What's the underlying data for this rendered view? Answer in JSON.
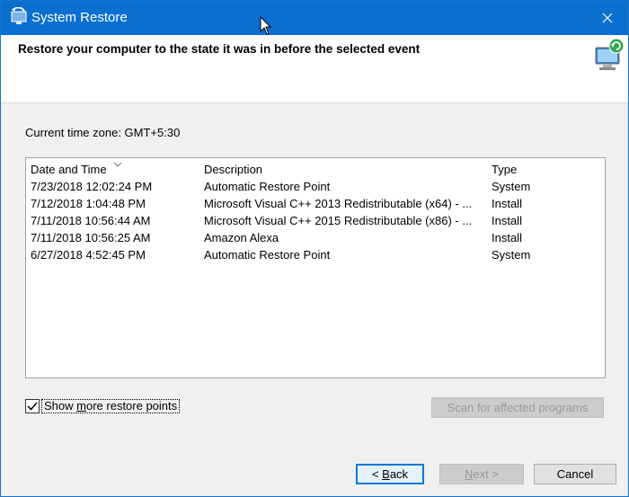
{
  "window": {
    "title": "System Restore"
  },
  "header": {
    "heading": "Restore your computer to the state it was in before the selected event"
  },
  "timezone": "Current time zone: GMT+5:30",
  "list": {
    "columns": [
      "Date and Time",
      "Description",
      "Type"
    ],
    "rows": [
      [
        "7/23/2018 12:02:24 PM",
        "Automatic Restore Point",
        "System"
      ],
      [
        "7/12/2018 1:04:48 PM",
        "Microsoft Visual C++ 2013 Redistributable (x64) - ...",
        "Install"
      ],
      [
        "7/11/2018 10:56:44 AM",
        "Microsoft Visual C++ 2015 Redistributable (x86) - ...",
        "Install"
      ],
      [
        "7/11/2018 10:56:25 AM",
        "Amazon Alexa",
        "Install"
      ],
      [
        "6/27/2018 4:52:45 PM",
        "Automatic Restore Point",
        "System"
      ]
    ]
  },
  "options": {
    "show_more_label": "Show more restore points",
    "show_more_checked": true
  },
  "buttons": {
    "scan": "Scan for affected programs",
    "back": "< Back",
    "next": "Next >",
    "cancel": "Cancel"
  },
  "colors": {
    "titlebar": "#0b6fd0",
    "accent": "#0078d7"
  },
  "icons": [
    "system-restore-app-icon",
    "close-icon",
    "system-restore-header-icon",
    "sort-indicator-icon",
    "checkmark-icon",
    "mouse-cursor-icon"
  ]
}
